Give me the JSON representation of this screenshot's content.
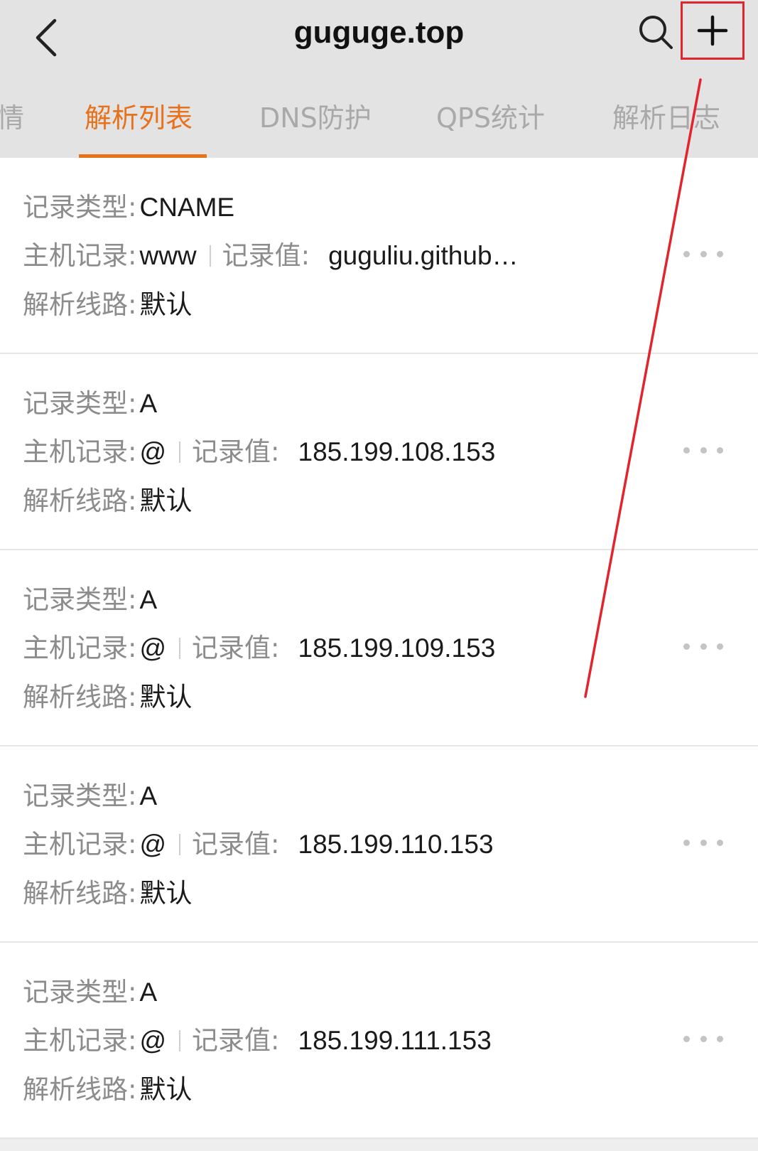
{
  "header": {
    "title": "guguge.top"
  },
  "tabs": [
    {
      "label": "情",
      "active": false
    },
    {
      "label": "解析列表",
      "active": true
    },
    {
      "label": "DNS防护",
      "active": false
    },
    {
      "label": "QPS统计",
      "active": false
    },
    {
      "label": "解析日志",
      "active": false
    }
  ],
  "labels": {
    "record_type": "记录类型:",
    "host_record": "主机记录:",
    "record_value": "记录值:",
    "line": "解析线路:"
  },
  "records": [
    {
      "type": "CNAME",
      "host": "www",
      "value": "guguliu.github…",
      "line": "默认"
    },
    {
      "type": "A",
      "host": "@",
      "value": "185.199.108.153",
      "line": "默认"
    },
    {
      "type": "A",
      "host": "@",
      "value": "185.199.109.153",
      "line": "默认"
    },
    {
      "type": "A",
      "host": "@",
      "value": "185.199.110.153",
      "line": "默认"
    },
    {
      "type": "A",
      "host": "@",
      "value": "185.199.111.153",
      "line": "默认"
    }
  ],
  "colors": {
    "accent": "#e8711c",
    "annotation": "#e0262c"
  }
}
